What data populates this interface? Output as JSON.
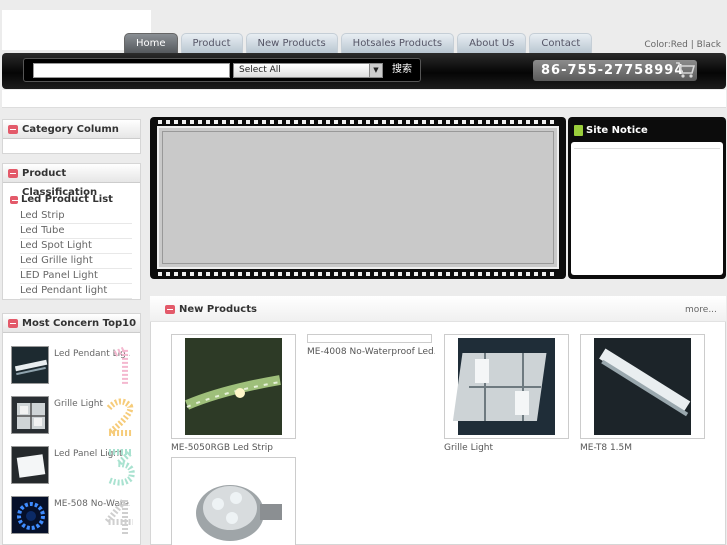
{
  "nav": {
    "tabs": [
      "Home",
      "Product",
      "New Products",
      "Hotsales Products",
      "About Us",
      "Contact"
    ]
  },
  "color_switch": {
    "label": "Color:",
    "options": [
      "Red",
      "Black"
    ],
    "separator": "|"
  },
  "search": {
    "value": "",
    "select_value": "Select All",
    "button_label": "搜索"
  },
  "phone": "86-755-27758994",
  "sidebar": {
    "category_column": "Category Column",
    "product_classification": "Product Classification",
    "list_title": "Led Product List",
    "items": [
      "Led Strip",
      "Led Tube",
      "Led Spot Light",
      "Led Grille light",
      "LED Panel Light",
      "Led Pendant light"
    ],
    "top10_title": "Most Concern Top10",
    "top10": [
      {
        "name": "Led Pendant Lig..."
      },
      {
        "name": "Grille Light"
      },
      {
        "name": "Led Panel Light"
      },
      {
        "name": "ME-508 No-Wate..."
      }
    ]
  },
  "site_notice": {
    "title": "Site Notice"
  },
  "new_products": {
    "title": "New Products",
    "more": "more...",
    "items": [
      {
        "name": "ME-5050RGB Led Strip"
      },
      {
        "name": "ME-4008 No-Waterproof Led..."
      },
      {
        "name": "Grille Light"
      },
      {
        "name": "ME-T8 1.5M"
      },
      {
        "name": ""
      }
    ]
  },
  "colors": {
    "accent": "#e35a6a",
    "nav_active": "#6f7478",
    "bar": "#0c0c0c"
  }
}
